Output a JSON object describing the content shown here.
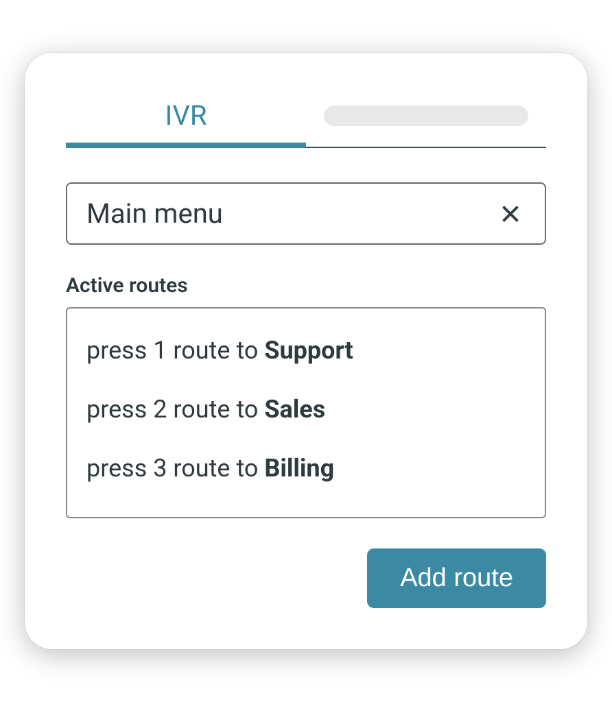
{
  "tabs": {
    "active_label": "IVR"
  },
  "menu_input": {
    "value": "Main menu"
  },
  "section_label": "Active routes",
  "routes": [
    {
      "prefix": "press 1 route to ",
      "dest": "Support"
    },
    {
      "prefix": "press 2 route to ",
      "dest": "Sales"
    },
    {
      "prefix": "press 3 route to ",
      "dest": "Billing"
    }
  ],
  "add_button_label": "Add route"
}
